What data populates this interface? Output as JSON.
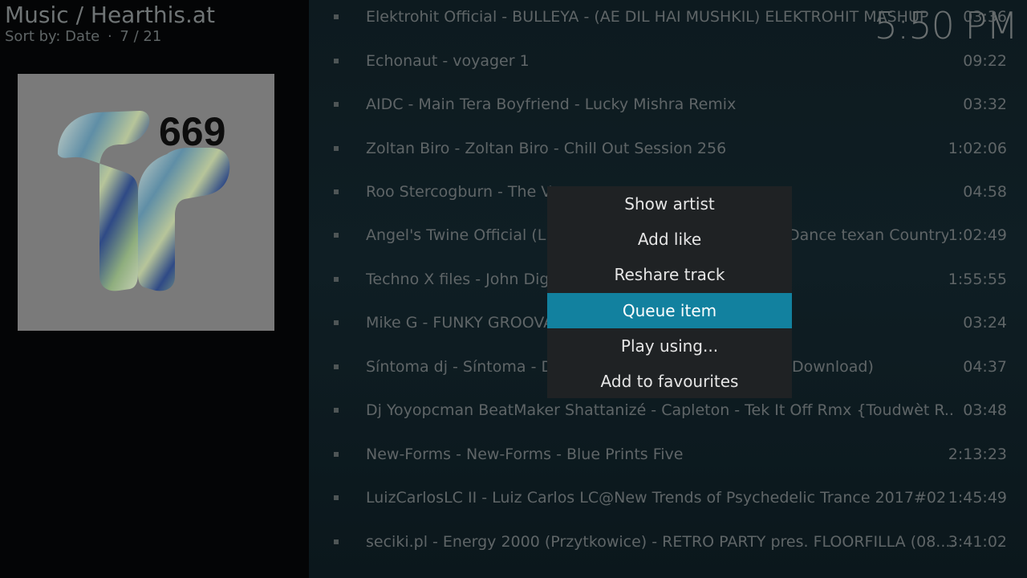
{
  "header": {
    "title": "Music / Hearthis.at",
    "sort_label": "Sort by: Date",
    "separator": "·",
    "position": "7 / 21"
  },
  "clock": "5:50 PM",
  "artwork": {
    "number": "669"
  },
  "tracks": [
    {
      "title": "Elektrohit Official - BULLEYA - (AE DIL HAI MUSHKIL) ELEKTROHIT MASHUP",
      "duration": "03:36"
    },
    {
      "title": "Echonaut - voyager 1",
      "duration": "09:22"
    },
    {
      "title": "AIDC - Main Tera Boyfriend -  Lucky Mishra Remix",
      "duration": "03:32"
    },
    {
      "title": "Zoltan Biro - Zoltan Biro - Chill Out Session 256",
      "duration": "1:02:06"
    },
    {
      "title": "Roo Stercogburn - The V",
      "duration": "04:58"
    },
    {
      "title": "Angel's Twine Official (L",
      "title_right": "Dance texan Country",
      "duration": "1:02:49"
    },
    {
      "title": "Techno X files - John Dig",
      "duration": "1:55:55"
    },
    {
      "title": "Mike G - FUNKY GROOVA",
      "duration": "03:24"
    },
    {
      "title": "Síntoma dj - Síntoma - D",
      "title_right": "Download)",
      "duration": "04:37"
    },
    {
      "title": "Dj Yoyopcman BeatMaker Shattanizé - Capleton - Tek It Off Rmx {Toudwèt R...",
      "duration": "03:48"
    },
    {
      "title": "New-Forms - New-Forms - Blue Prints Five",
      "duration": "2:13:23"
    },
    {
      "title": "LuizCarlosLC II - Luiz Carlos LC@New Trends of Psychedelic Trance 2017#02",
      "duration": "1:45:49"
    },
    {
      "title": "seciki.pl - Energy 2000 (Przytkowice) - RETRO PARTY pres. FLOORFILLA (08....",
      "duration": "3:41:02"
    }
  ],
  "context_menu": {
    "items": [
      "Show artist",
      "Add like",
      "Reshare track",
      "Queue item",
      "Play using...",
      "Add to favourites"
    ],
    "focused_index": 3
  },
  "colors": {
    "accent": "#12819f"
  }
}
